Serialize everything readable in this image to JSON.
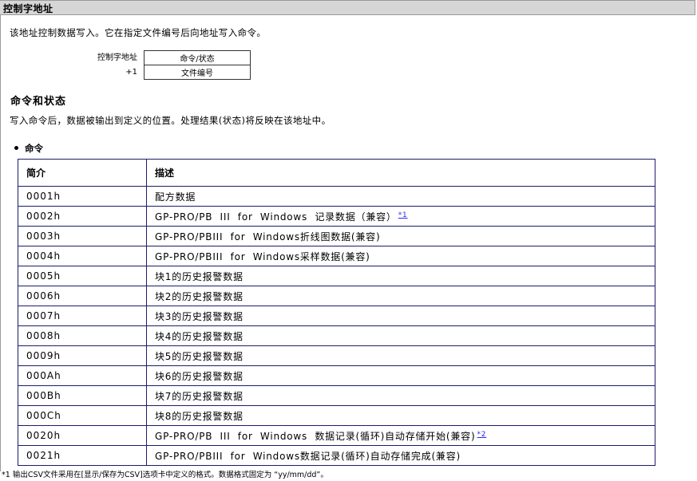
{
  "page_title": "控制字地址",
  "intro": "该地址控制数据写入。它在指定文件编号后向地址写入命令。",
  "address": {
    "labels": [
      "控制字地址",
      "+1"
    ],
    "cells": [
      "命令/状态",
      "文件编号"
    ]
  },
  "section": {
    "title": "命令和状态",
    "desc": "写入命令后，数据被输出到定义的位置。处理结果(状态)将反映在该地址中。"
  },
  "bullet": "命令",
  "table": {
    "headers": [
      "简介",
      "描述"
    ],
    "rows": [
      {
        "code": "0001h",
        "desc": "配方数据",
        "fn": ""
      },
      {
        "code": "0002h",
        "desc": "GP-PRO/PB  III  for  Windows  记录数据（兼容）",
        "fn": "*1"
      },
      {
        "code": "0003h",
        "desc": "GP-PRO/PBIII  for  Windows折线图数据(兼容)",
        "fn": ""
      },
      {
        "code": "0004h",
        "desc": "GP-PRO/PBIII  for  Windows采样数据(兼容)",
        "fn": ""
      },
      {
        "code": "0005h",
        "desc": "块1的历史报警数据",
        "fn": ""
      },
      {
        "code": "0006h",
        "desc": "块2的历史报警数据",
        "fn": ""
      },
      {
        "code": "0007h",
        "desc": "块3的历史报警数据",
        "fn": ""
      },
      {
        "code": "0008h",
        "desc": "块4的历史报警数据",
        "fn": ""
      },
      {
        "code": "0009h",
        "desc": "块5的历史报警数据",
        "fn": ""
      },
      {
        "code": "000Ah",
        "desc": "块6的历史报警数据",
        "fn": ""
      },
      {
        "code": "000Bh",
        "desc": "块7的历史报警数据",
        "fn": ""
      },
      {
        "code": "000Ch",
        "desc": "块8的历史报警数据",
        "fn": ""
      },
      {
        "code": "0020h",
        "desc": "GP-PRO/PB  III  for  Windows  数据记录(循环)自动存储开始(兼容)",
        "fn": "*2"
      },
      {
        "code": "0021h",
        "desc": "GP-PRO/PBIII  for  Windows数据记录(循环)自动存储完成(兼容)",
        "fn": ""
      }
    ]
  },
  "footnote": "*1  输出CSV文件采用在[显示/保存为CSV]选项卡中定义的格式。数据格式固定为 “yy/mm/dd”。"
}
